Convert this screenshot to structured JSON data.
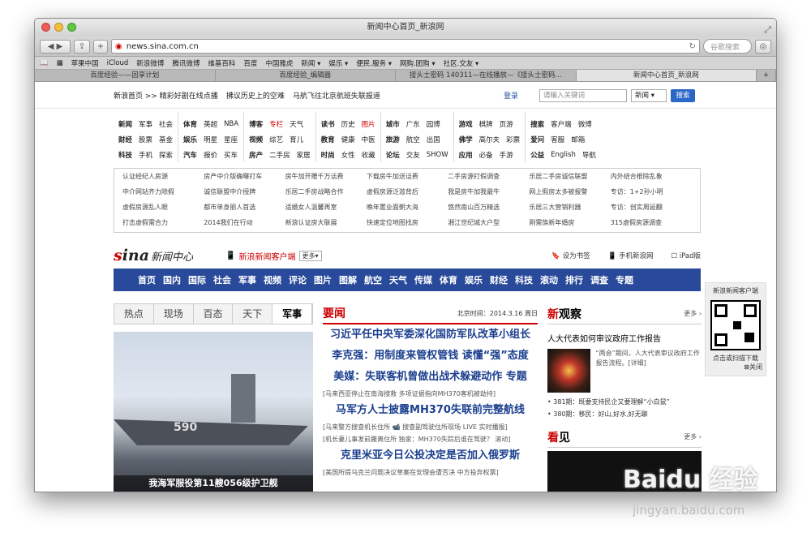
{
  "window": {
    "title": "新闻中心首页_新浪网"
  },
  "toolbar": {
    "url": "news.sina.com.cn",
    "search_placeholder": "谷歌搜索"
  },
  "bookmarks": [
    "苹果中国",
    "iCloud",
    "新浪微博",
    "腾讯微博",
    "维基百科",
    "百度",
    "中国雅虎",
    "新闻 ▾",
    "娱乐 ▾",
    "便民.服务 ▾",
    "网购.团购 ▾",
    "社区.交友 ▾"
  ],
  "tabs": [
    {
      "label": "百度经验——回享计划",
      "active": false
    },
    {
      "label": "百度经验_编辑器",
      "active": false
    },
    {
      "label": "接头士密码 140311—在线播放—《接头士密码...",
      "active": false
    },
    {
      "label": "新闻中心首页_新浪网",
      "active": true
    }
  ],
  "topbar": {
    "links": [
      "新浪首页 >> 精彩好剧在线点播",
      "拂议历史上的空难",
      "马航飞往北京航班失联报道"
    ],
    "login": "登录",
    "keyword_placeholder": "请输入关键词",
    "select": "新闻 ▾",
    "search_btn": "搜索"
  },
  "directory": [
    [
      [
        "新闻",
        "军事",
        "社会"
      ],
      [
        "财经",
        "股票",
        "基金"
      ],
      [
        "科技",
        "手机",
        "探索"
      ]
    ],
    [
      [
        "体育",
        "英超",
        "NBA"
      ],
      [
        "娱乐",
        "明星",
        "星座"
      ],
      [
        "汽车",
        "报价",
        "买车"
      ]
    ],
    [
      [
        "博客",
        "专栏",
        "天气"
      ],
      [
        "视频",
        "综艺",
        "育儿"
      ],
      [
        "房产",
        "二手房",
        "家居"
      ]
    ],
    [
      [
        "读书",
        "历史",
        "图片"
      ],
      [
        "教育",
        "健康",
        "中医"
      ],
      [
        "时尚",
        "女性",
        "收藏"
      ]
    ],
    [
      [
        "城市",
        "广东",
        "园博"
      ],
      [
        "旅游",
        "航空",
        "出国"
      ],
      [
        "论坛",
        "交友",
        "SHOW"
      ]
    ],
    [
      [
        "游戏",
        "棋牌",
        "页游"
      ],
      [
        "佛学",
        "高尔夫",
        "彩票"
      ],
      [
        "应用",
        "必备",
        "手游"
      ]
    ],
    [
      [
        "搜索",
        "客户端",
        "微博"
      ],
      [
        "爱问",
        "客服",
        "邮箱"
      ],
      [
        "公益",
        "English",
        "导航"
      ]
    ]
  ],
  "ads": [
    "认证经纪人房源",
    "房产中介版确曝打车",
    "房牛加开赠千万话费",
    "下载房牛加送话费",
    "二手房源打假调查",
    "乐居二手房诚信联盟",
    "内外结合根除乱象",
    "中介网站齐力除假",
    "诚信联盟中介授牌",
    "乐居二手房战略合作",
    "虚假房源泛滥背后",
    "我是房牛加我最牛",
    "网上假房太多被报警",
    "专访：1+2孙小明",
    "虚假房源乱人眼",
    "都市单身丽人首选",
    "适婚女人温馨再室",
    "晚年置业面朝大海",
    "悠然南山百万精选",
    "乐居三大营销利器",
    "专访：创实周延翻",
    "打击虚假需合力",
    "2014我们在行动",
    "新浪认证房大联展",
    "快速定位地图找房",
    "湘江世纪城大户型",
    "刚需族新年婚房",
    "315虚假房源调查"
  ],
  "sina": {
    "logo": "sina",
    "logo_suffix": "新闻中心",
    "client": "新浪新闻客户端",
    "more": "更多▾",
    "links": [
      "设为书签",
      "手机新浪网",
      "iPad版"
    ]
  },
  "mainnav": [
    "首页",
    "国内",
    "国际",
    "社会",
    "军事",
    "视频",
    "评论",
    "图片",
    "图解",
    "航空",
    "天气",
    "传媒",
    "体育",
    "娱乐",
    "财经",
    "科技",
    "滚动",
    "排行",
    "调查",
    "专题"
  ],
  "qr": {
    "title": "新浪新闻客户端",
    "caption": "点击或扫描下载",
    "close": "关闭"
  },
  "left": {
    "tabs": [
      "热点",
      "现场",
      "百态",
      "天下",
      "军事"
    ],
    "active": 4,
    "caption": "我海军服役第11艘056级护卫舰",
    "hull": "590"
  },
  "middle": {
    "title": "要闻",
    "time": "北京时间：2014.3.16 周日",
    "items": [
      {
        "type": "hl",
        "text": "习近平任中央军委深化国防军队改革小组长"
      },
      {
        "type": "hl",
        "text": "李克强：用制度来管权管钱 读懂“强”态度"
      },
      {
        "type": "hl",
        "text": "美媒：失联客机曾做出战术躲避动作 专题"
      },
      {
        "type": "sub",
        "text": "[马来西亚停止在南海搜救 多项证据指向MH370客机被劫持]"
      },
      {
        "type": "hl",
        "text": "马军方人士披露MH370失联前完整航线"
      },
      {
        "type": "sub",
        "text": "[马来警方搜查机长住所 📹 搜查副驾驶住所现场 LIVE 实时播报]"
      },
      {
        "type": "sub",
        "text": "[机长妻儿事发前搬离住所 独家：MH370失踪后谁在驾驶？ 滚动]"
      },
      {
        "type": "hl",
        "text": "克里米亚今日公投决定是否加入俄罗斯"
      },
      {
        "type": "sub",
        "text": "[美国所提乌克兰问题决议草案在安理会遭否决 中方投弃权票]"
      }
    ]
  },
  "right": {
    "title_main": "新",
    "title_rest": "观察",
    "more": "更多 ›",
    "headline": "人大代表如何审议政府工作报告",
    "text": "“两会”期间，人大代表审议政府工作报告流程。[详细]",
    "list": [
      "381期：既要支持民企又要理解“小白鼠”",
      "380期：移民：好山,好水,好无聊"
    ],
    "title2_main": "看",
    "title2_rest": "见",
    "more2": "更多 ›"
  },
  "watermark": {
    "logo": "Baidu 经验",
    "url": "jingyan.baidu.com"
  }
}
